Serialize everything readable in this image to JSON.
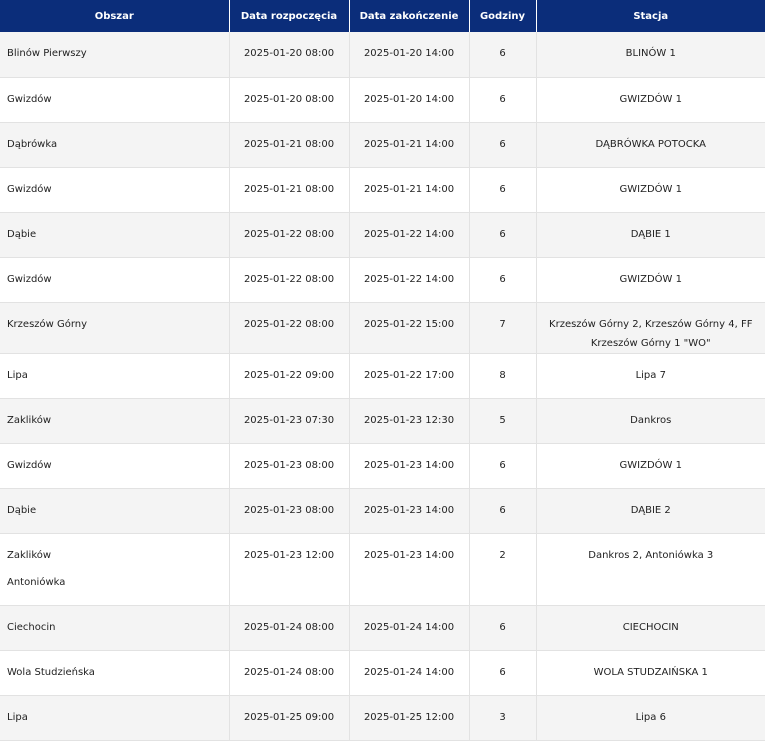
{
  "table": {
    "headers": [
      "Obszar",
      "Data rozpoczęcia",
      "Data zakończenie",
      "Godziny",
      "Stacja"
    ],
    "rows": [
      {
        "area": [
          "Blinów Pierwszy"
        ],
        "start": "2025-01-20 08:00",
        "end": "2025-01-20 14:00",
        "hours": "6",
        "station": "BLINÓW 1"
      },
      {
        "area": [
          "Gwizdów"
        ],
        "start": "2025-01-20 08:00",
        "end": "2025-01-20 14:00",
        "hours": "6",
        "station": "GWIZDÓW 1"
      },
      {
        "area": [
          "Dąbrówka"
        ],
        "start": "2025-01-21 08:00",
        "end": "2025-01-21 14:00",
        "hours": "6",
        "station": "DĄBRÓWKA POTOCKA"
      },
      {
        "area": [
          "Gwizdów"
        ],
        "start": "2025-01-21 08:00",
        "end": "2025-01-21 14:00",
        "hours": "6",
        "station": "GWIZDÓW 1"
      },
      {
        "area": [
          "Dąbie"
        ],
        "start": "2025-01-22 08:00",
        "end": "2025-01-22 14:00",
        "hours": "6",
        "station": "DĄBIE 1"
      },
      {
        "area": [
          "Gwizdów"
        ],
        "start": "2025-01-22 08:00",
        "end": "2025-01-22 14:00",
        "hours": "6",
        "station": "GWIZDÓW 1"
      },
      {
        "area": [
          "Krzeszów Górny"
        ],
        "start": "2025-01-22 08:00",
        "end": "2025-01-22 15:00",
        "hours": "7",
        "station": "Krzeszów Górny 2, Krzeszów Górny 4, FF Krzeszów Górny 1 \"WO\""
      },
      {
        "area": [
          "Lipa"
        ],
        "start": "2025-01-22 09:00",
        "end": "2025-01-22 17:00",
        "hours": "8",
        "station": "Lipa 7"
      },
      {
        "area": [
          "Zaklików"
        ],
        "start": "2025-01-23 07:30",
        "end": "2025-01-23 12:30",
        "hours": "5",
        "station": "Dankros"
      },
      {
        "area": [
          "Gwizdów"
        ],
        "start": "2025-01-23 08:00",
        "end": "2025-01-23 14:00",
        "hours": "6",
        "station": "GWIZDÓW 1"
      },
      {
        "area": [
          "Dąbie"
        ],
        "start": "2025-01-23 08:00",
        "end": "2025-01-23 14:00",
        "hours": "6",
        "station": "DĄBIE 2"
      },
      {
        "area": [
          "Zaklików",
          "Antoniówka"
        ],
        "start": "2025-01-23 12:00",
        "end": "2025-01-23 14:00",
        "hours": "2",
        "station": "Dankros 2, Antoniówka 3"
      },
      {
        "area": [
          "Ciechocin"
        ],
        "start": "2025-01-24 08:00",
        "end": "2025-01-24 14:00",
        "hours": "6",
        "station": "CIECHOCIN"
      },
      {
        "area": [
          "Wola Studzieńska"
        ],
        "start": "2025-01-24 08:00",
        "end": "2025-01-24 14:00",
        "hours": "6",
        "station": "WOLA STUDZAIŃSKA 1"
      },
      {
        "area": [
          "Lipa"
        ],
        "start": "2025-01-25 09:00",
        "end": "2025-01-25 12:00",
        "hours": "3",
        "station": "Lipa 6"
      }
    ]
  },
  "colors": {
    "header_bg": "#0b2d7a",
    "header_text": "#ffffff",
    "row_alt": "#f4f4f4"
  }
}
